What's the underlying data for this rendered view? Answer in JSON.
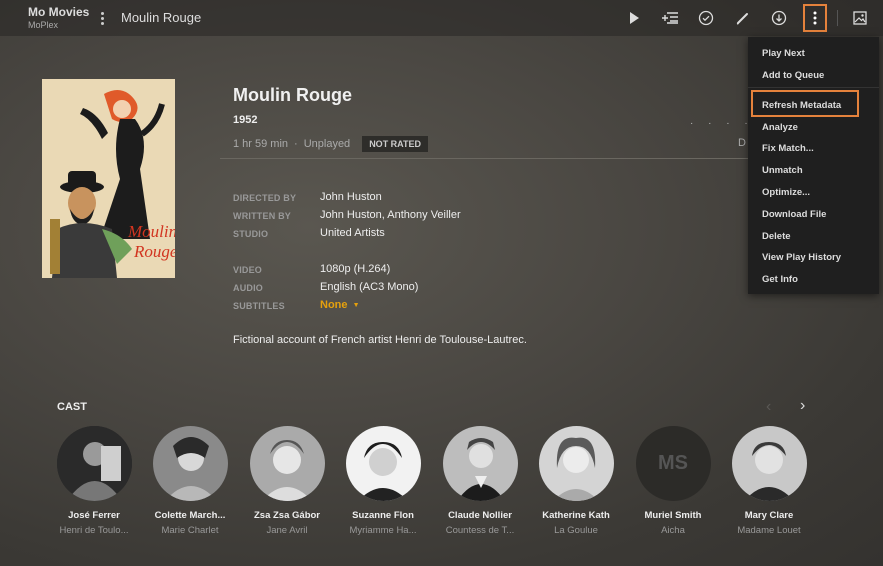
{
  "header": {
    "server_name": "Mo Movies",
    "server_sub": "MoPlex",
    "page_title": "Moulin Rouge"
  },
  "movie": {
    "title": "Moulin Rouge",
    "year": "1952",
    "duration": "1 hr 59 min",
    "separator": "·",
    "status": "Unplayed",
    "rating": "NOT RATED",
    "rating_dots": "· · · · ·",
    "partial_right_text": "D",
    "directed_by_label": "DIRECTED BY",
    "directed_by": "John Huston",
    "written_by_label": "WRITTEN BY",
    "written_by": "John Huston, Anthony Veiller",
    "studio_label": "STUDIO",
    "studio": "United Artists",
    "video_label": "VIDEO",
    "video": "1080p (H.264)",
    "audio_label": "AUDIO",
    "audio": "English (AC3 Mono)",
    "subtitles_label": "SUBTITLES",
    "subtitles": "None",
    "summary": "Fictional account of French artist Henri de Toulouse-Lautrec.",
    "poster_text_top": "Moulin",
    "poster_text_bottom": "Rouge"
  },
  "menu": {
    "items": [
      {
        "label": "Play Next"
      },
      {
        "label": "Add to Queue"
      },
      {
        "label": "Refresh Metadata"
      },
      {
        "label": "Analyze"
      },
      {
        "label": "Fix Match..."
      },
      {
        "label": "Unmatch"
      },
      {
        "label": "Optimize..."
      },
      {
        "label": "Download File"
      },
      {
        "label": "Delete"
      },
      {
        "label": "View Play History"
      },
      {
        "label": "Get Info"
      }
    ]
  },
  "cast": {
    "title": "CAST",
    "members": [
      {
        "name": "José Ferrer",
        "role": "Henri de Toulo..."
      },
      {
        "name": "Colette March...",
        "role": "Marie Charlet"
      },
      {
        "name": "Zsa Zsa Gábor",
        "role": "Jane Avril"
      },
      {
        "name": "Suzanne Flon",
        "role": "Myriamme Ha..."
      },
      {
        "name": "Claude Nollier",
        "role": "Countess de T..."
      },
      {
        "name": "Katherine Kath",
        "role": "La Goulue"
      },
      {
        "name": "Muriel Smith",
        "role": "Aicha",
        "initials": "MS"
      },
      {
        "name": "Mary Clare",
        "role": "Madame Louet"
      }
    ]
  },
  "colors": {
    "accent": "#e5a00d",
    "highlight_border": "#e5823c"
  },
  "icons": [
    "more-vertical-icon",
    "play-icon",
    "add-to-playlist-icon",
    "check-circle-icon",
    "edit-pencil-icon",
    "download-icon",
    "image-icon",
    "chevron-left-icon",
    "chevron-right-icon",
    "caret-down-icon"
  ]
}
